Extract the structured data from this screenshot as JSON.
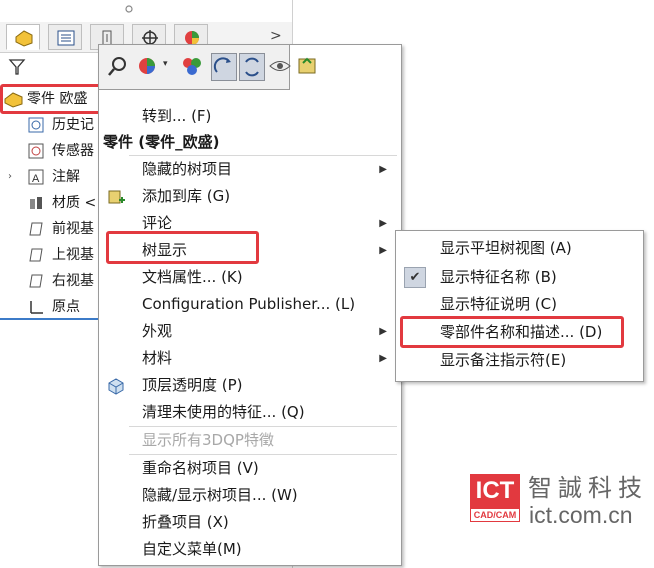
{
  "tree": {
    "root_label": "零件 欧盛",
    "items": [
      {
        "label": "历史记",
        "icon": "history-icon"
      },
      {
        "label": "传感器",
        "icon": "sensor-icon"
      },
      {
        "label": "注解",
        "icon": "annotation-icon"
      },
      {
        "label": "材质 <",
        "icon": "material-icon"
      },
      {
        "label": "前视基",
        "icon": "plane-icon"
      },
      {
        "label": "上视基",
        "icon": "plane-icon"
      },
      {
        "label": "右视基",
        "icon": "plane-icon"
      },
      {
        "label": "原点",
        "icon": "origin-icon"
      }
    ]
  },
  "context_menu": {
    "goto": "转到... (F)",
    "header": "零件 (零件_欧盛)",
    "items": [
      {
        "label": "隐藏的树项目",
        "submenu": true
      },
      {
        "label": "添加到库 (G)",
        "icon": "add-to-library-icon"
      },
      {
        "label": "评论",
        "submenu": true
      },
      {
        "label": "树显示",
        "submenu": true
      },
      {
        "label": "文档属性... (K)"
      },
      {
        "label": "Configuration Publisher... (L)"
      },
      {
        "label": "外观",
        "submenu": true
      },
      {
        "label": "材料",
        "submenu": true
      },
      {
        "label": "顶层透明度 (P)",
        "icon": "transparency-icon"
      },
      {
        "label": "清理未使用的特征... (Q)"
      },
      {
        "label": "显示所有3DQP特徵",
        "disabled": true
      },
      {
        "label": "重命名树项目 (V)"
      },
      {
        "label": "隐藏/显示树项目... (W)"
      },
      {
        "label": "折叠项目 (X)"
      },
      {
        "label": "自定义菜单(M)"
      }
    ]
  },
  "submenu": {
    "items": [
      {
        "label": "显示平坦树视图 (A)"
      },
      {
        "label": "显示特征名称 (B)",
        "checked": true
      },
      {
        "label": "显示特征说明 (C)"
      },
      {
        "label": "零部件名称和描述... (D)"
      },
      {
        "label": "显示备注指示符(E)"
      }
    ]
  },
  "watermark": {
    "logo_text": "ICT",
    "logo_sub": "CAD/CAM",
    "name_cn": "智誠科技",
    "url": "ict.com.cn"
  },
  "colors": {
    "highlight": "#e2393f",
    "tree_line": "#3c7bc8"
  }
}
